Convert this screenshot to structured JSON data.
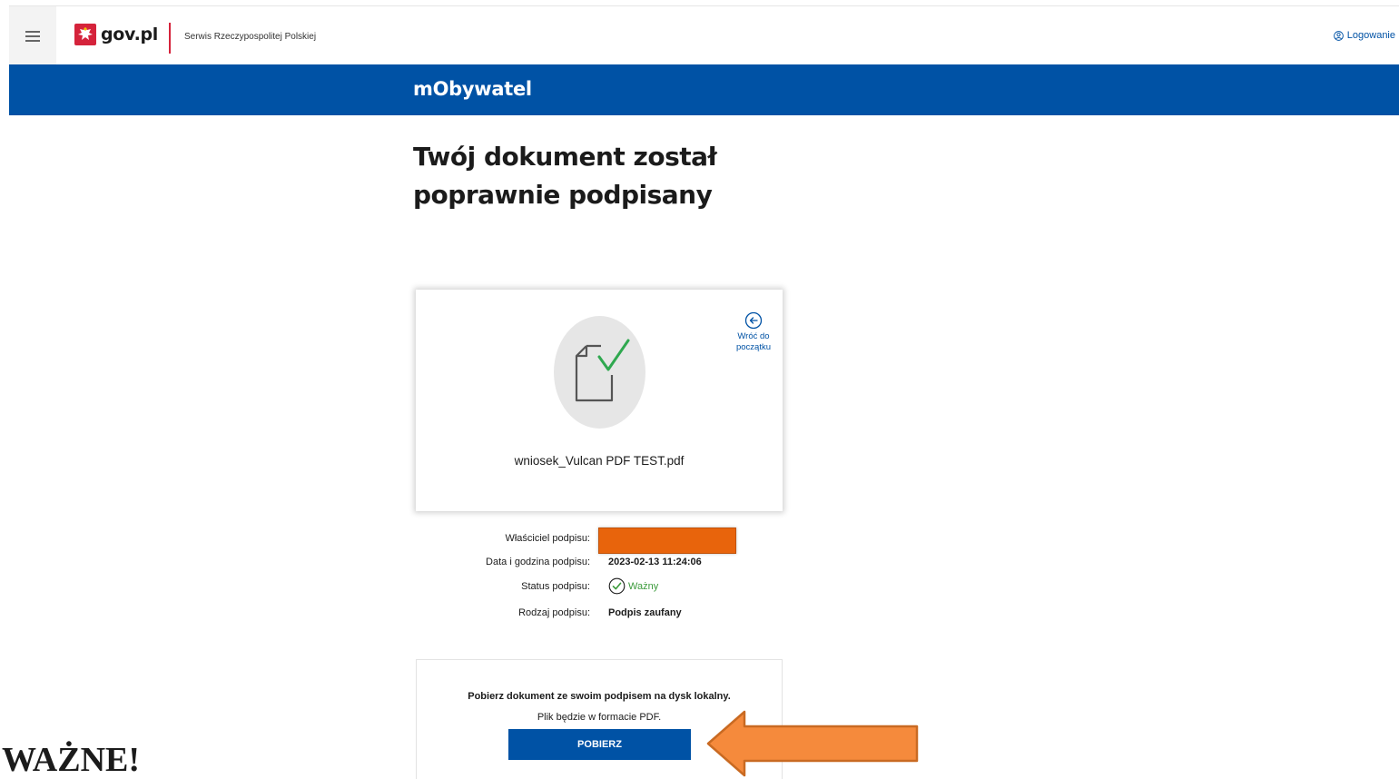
{
  "header": {
    "menu_icon": "hamburger-menu-icon",
    "logo_text": "gov.pl",
    "service_name": "Serwis Rzeczypospolitej Polskiej",
    "login_label": "Logowanie",
    "login_icon": "user-circle-icon"
  },
  "banner": {
    "title": "mObywatel"
  },
  "main": {
    "heading": "Twój dokument został poprawnie podpisany"
  },
  "document": {
    "file_name": "wniosek_Vulcan PDF TEST.pdf",
    "icon": "document-check-icon",
    "back_label": "Wróć do początku",
    "back_icon": "arrow-left-circle-icon"
  },
  "signature": {
    "owner_label": "Właściciel podpisu:",
    "owner_value": "",
    "date_label": "Data i godzina podpisu:",
    "date_value": "2023-02-13 11:24:06",
    "status_label": "Status podpisu:",
    "status_value": "Ważny",
    "status_icon": "check-circle-icon",
    "type_label": "Rodzaj podpisu:",
    "type_value": "Podpis zaufany"
  },
  "download": {
    "title": "Pobierz dokument ze swoim podpisem na dysk lokalny.",
    "subtitle": "Plik będzie w formacie PDF.",
    "button_label": "POBIERZ"
  },
  "annotation": {
    "important_text": "WAŻNE!",
    "arrow_color": "#f58a3c",
    "redaction_color": "#e8640c"
  },
  "colors": {
    "brand_blue": "#0052a5",
    "divider_red": "#d5233b",
    "valid_green": "#3a9a3a"
  }
}
